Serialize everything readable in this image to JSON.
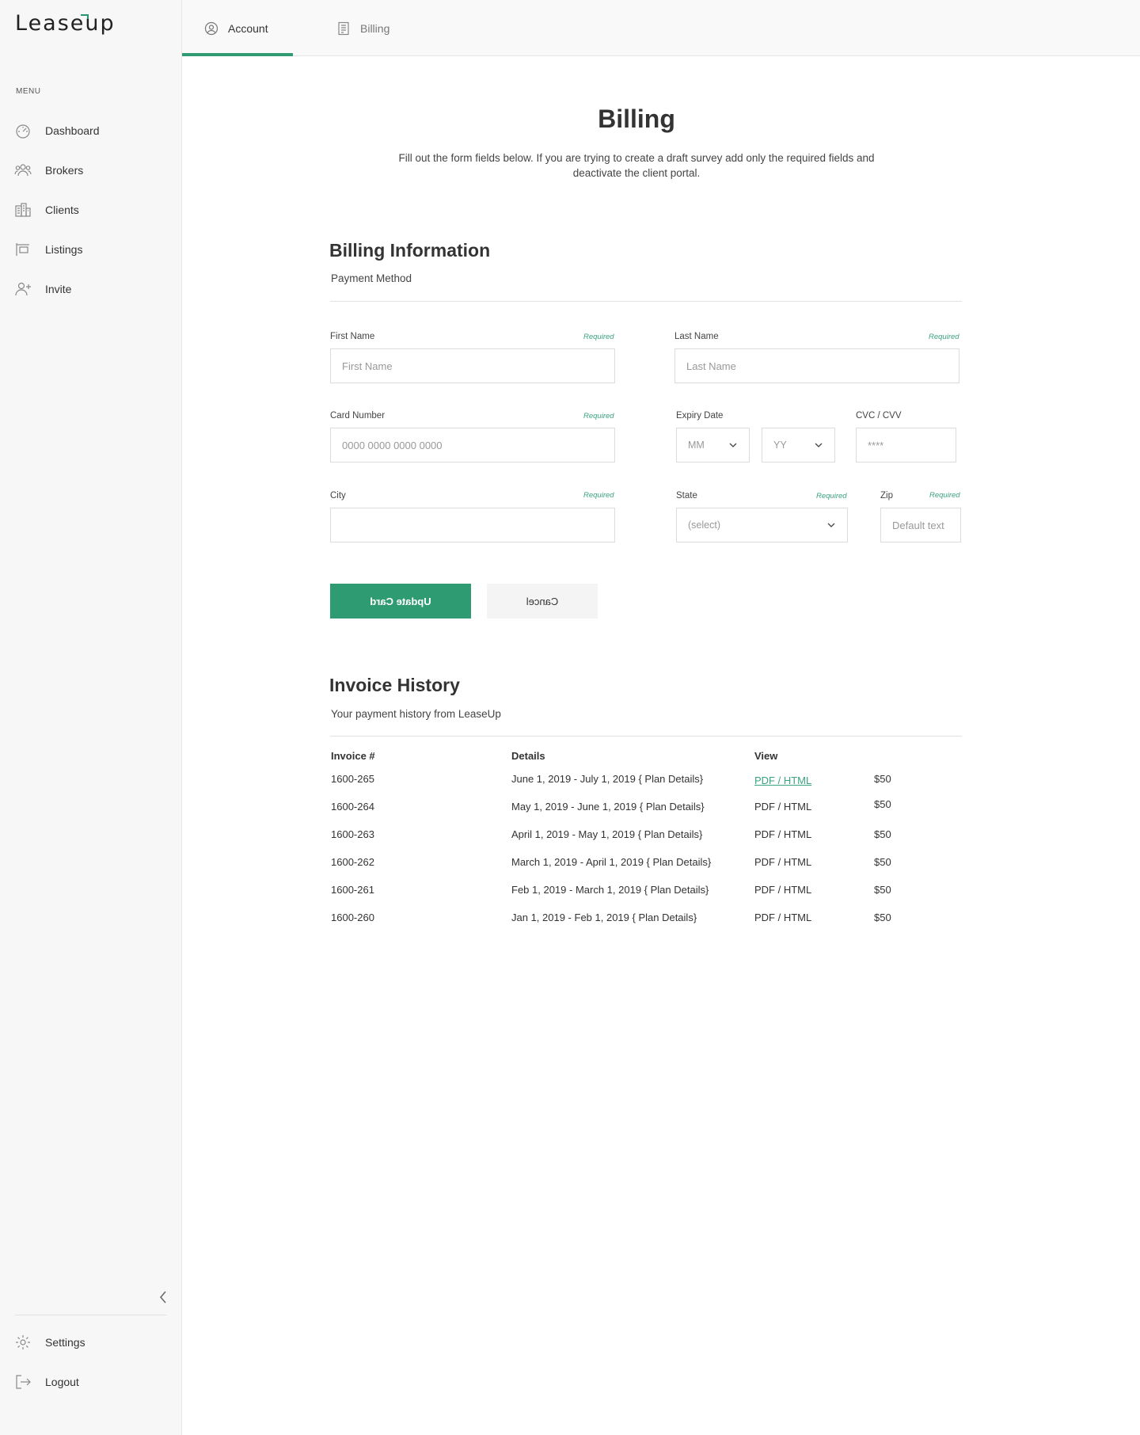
{
  "app": {
    "logo_text": "Leaseup"
  },
  "sidebar": {
    "menu_label": "MENU",
    "items": [
      {
        "label": "Dashboard",
        "icon": "dashboard-icon"
      },
      {
        "label": "Brokers",
        "icon": "brokers-icon"
      },
      {
        "label": "Clients",
        "icon": "clients-icon"
      },
      {
        "label": "Listings",
        "icon": "listings-icon"
      },
      {
        "label": "Invite",
        "icon": "invite-icon"
      }
    ],
    "bottom_items": [
      {
        "label": "Settings",
        "icon": "gear-icon"
      },
      {
        "label": "Logout",
        "icon": "logout-icon"
      }
    ]
  },
  "tabs": [
    {
      "label": "Account",
      "icon": "user-circle-icon",
      "active": true
    },
    {
      "label": "Billing",
      "icon": "document-icon",
      "active": false
    }
  ],
  "page": {
    "title": "Billing",
    "description": "Fill out the form fields below. If you are trying to create a draft survey add only the required fields and deactivate the client portal."
  },
  "billing_info": {
    "title": "Billing Information",
    "subtitle": "Payment Method",
    "required_text": "Required",
    "fields": {
      "first_name": {
        "label": "First Name",
        "placeholder": "First Name",
        "value": ""
      },
      "last_name": {
        "label": "Last Name",
        "placeholder": "Last Name",
        "value": ""
      },
      "card_number": {
        "label": "Card Number",
        "placeholder": "0000 0000 0000 0000",
        "value": ""
      },
      "expiry": {
        "label": "Expiry Date",
        "month_placeholder": "MM",
        "year_placeholder": "YY"
      },
      "cvc": {
        "label": "CVC / CVV",
        "placeholder": "****",
        "value": ""
      },
      "city": {
        "label": "City",
        "placeholder": "",
        "value": ""
      },
      "state": {
        "label": "State",
        "placeholder": "(select)"
      },
      "zip": {
        "label": "Zip",
        "placeholder": "Default text",
        "value": ""
      }
    },
    "buttons": {
      "update": "Update Card",
      "cancel": "Cancel"
    }
  },
  "invoice_history": {
    "title": "Invoice History",
    "subtitle": "Your payment history from LeaseUp",
    "columns": [
      "Invoice #",
      "Details",
      "View"
    ],
    "rows": [
      {
        "invoice": "1600-265",
        "details": "June 1, 2019 - July 1,  2019 { Plan Details}",
        "view": "PDF / HTML",
        "amount": "$50"
      },
      {
        "invoice": "1600-264",
        "details": "May 1, 2019 - June 1,  2019 { Plan Details}",
        "view": "PDF / HTML",
        "amount": "$50"
      },
      {
        "invoice": "1600-263",
        "details": "April 1, 2019 - May 1,  2019 { Plan Details}",
        "view": "PDF / HTML",
        "amount": "$50"
      },
      {
        "invoice": "1600-262",
        "details": "March 1, 2019 - April 1,  2019 { Plan Details}",
        "view": "PDF / HTML",
        "amount": "$50"
      },
      {
        "invoice": "1600-261",
        "details": "Feb 1, 2019 - March 1,  2019 { Plan Details}",
        "view": "PDF / HTML",
        "amount": "$50"
      },
      {
        "invoice": "1600-260",
        "details": "Jan 1, 2019 - Feb 1,  2019 { Plan Details}",
        "view": "PDF / HTML",
        "amount": "$50"
      }
    ]
  },
  "colors": {
    "accent": "#2e9b73",
    "required": "#3aa37f",
    "sidebar_bg": "#f7f7f7"
  }
}
